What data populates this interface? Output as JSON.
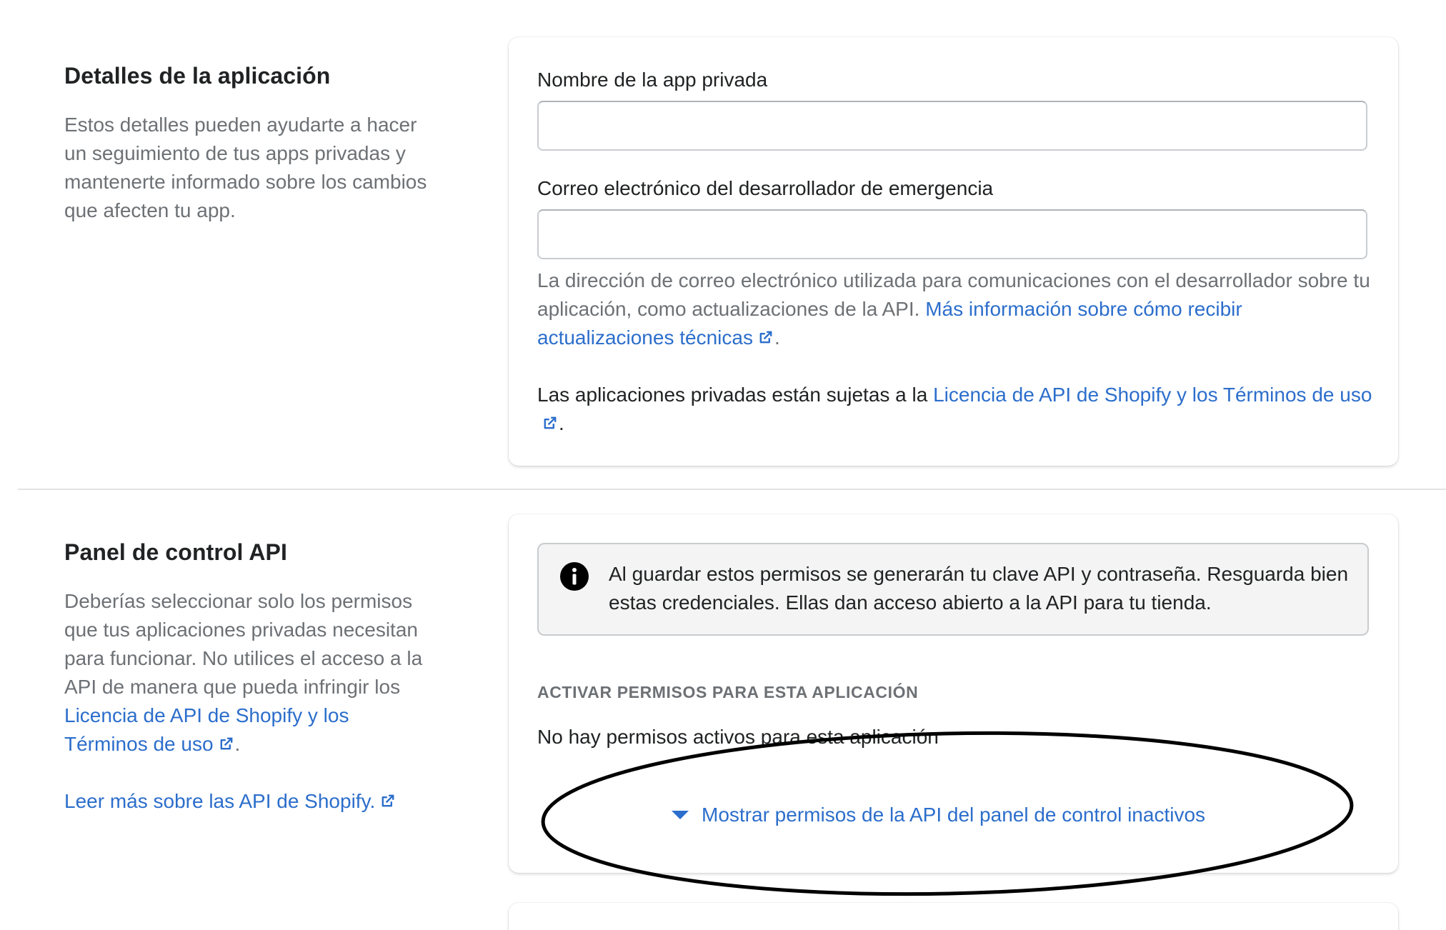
{
  "section_app_details": {
    "title": "Detalles de la aplicación",
    "description": "Estos detalles pueden ayudarte a hacer un seguimiento de tus apps privadas y mantenerte informado sobre los cambios que afecten tu app.",
    "fields": {
      "app_name": {
        "label": "Nombre de la app privada",
        "value": "",
        "placeholder": ""
      },
      "emergency_email": {
        "label": "Correo electrónico del desarrollador de emergencia",
        "value": "",
        "placeholder": ""
      }
    },
    "email_help": {
      "text": "La dirección de correo electrónico utilizada para comunicaciones con el desarrollador sobre tu aplicación, como actualizaciones de la API. ",
      "link": "Más información sobre cómo recibir actualizaciones técnicas",
      "end": "."
    },
    "license_note": {
      "text": "Las aplicaciones privadas están sujetas a la ",
      "link": "Licencia de API de Shopify y los Términos de uso",
      "end": "."
    }
  },
  "section_api_panel": {
    "title": "Panel de control API",
    "description": {
      "text": "Deberías seleccionar solo los permisos que tus aplicaciones privadas necesitan para funcionar. No utilices el acceso a la API de manera que pueda infringir los ",
      "link": "Licencia de API de Shopify y los Términos de uso",
      "end": "."
    },
    "read_more_link": "Leer más sobre las API de Shopify.",
    "banner_text": "Al guardar estos permisos se generarán tu clave API y contraseña. Resguarda bien estas credenciales. Ellas dan acceso abierto a la API para tu tienda.",
    "permissions_heading": "ACTIVAR PERMISOS PARA ESTA APLICACIÓN",
    "no_permissions_text": "No hay permisos activos para esta aplicación",
    "show_inactive_button": "Mostrar permisos de la API del panel de control inactivos"
  },
  "icons": {
    "external_link": "external-link-icon",
    "info": "info-icon",
    "caret": "caret-down-icon"
  },
  "colors": {
    "link": "#2c6ecb",
    "text": "#202223",
    "subdued": "#6d7175",
    "banner_bg": "#f4f4f4",
    "annotation": "#000000"
  }
}
